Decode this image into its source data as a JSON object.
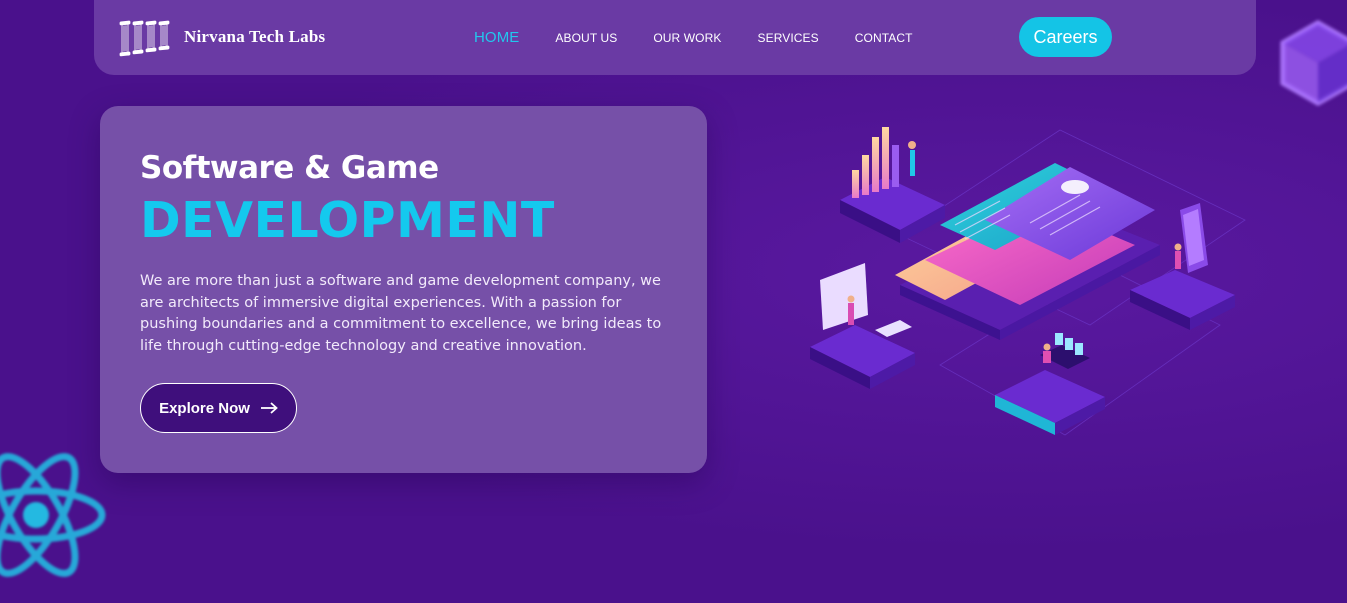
{
  "brand": {
    "name": "Nirvana Tech Labs",
    "logo_icon": "pillars-icon"
  },
  "nav": {
    "items": [
      {
        "label": "HOME",
        "active": true
      },
      {
        "label": "ABOUT US",
        "active": false
      },
      {
        "label": "OUR WORK",
        "active": false
      },
      {
        "label": "SERVICES",
        "active": false
      },
      {
        "label": "CONTACT",
        "active": false
      }
    ],
    "careers_label": "Careers"
  },
  "hero": {
    "subtitle": "Software & Game",
    "title": "DEVELOPMENT",
    "description": "We are more than just a software and game development company, we are architects of immersive digital experiences. With a passion for pushing boundaries and a commitment to excellence, we bring ideas to life through cutting-edge technology and creative innovation.",
    "button_label": "Explore Now",
    "button_icon": "arrow-right-icon"
  },
  "decorations": {
    "left_icon": "react-atom-icon",
    "right_icon": "cube-icon",
    "illustration": "isometric-development-illustration"
  },
  "colors": {
    "background": "#4a118c",
    "navbar": "#6a3aa4",
    "card": "#7650a8",
    "accent": "#14c9ee",
    "button_dark": "#3f0f7c"
  }
}
